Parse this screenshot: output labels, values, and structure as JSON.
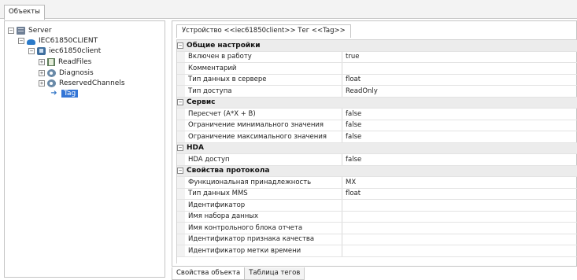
{
  "top_tab": {
    "label": "Объекты"
  },
  "tree": {
    "server": "Server",
    "client": "IEC61850CLIENT",
    "device": "iec61850client",
    "readfiles": "ReadFiles",
    "diagnosis": "Diagnosis",
    "reserved": "ReservedChannels",
    "tag": "Tag"
  },
  "device_tab": {
    "label": "Устройство <<iec61850client>> Тег  <<Tag>>"
  },
  "grid": {
    "cat_general": "Общие настройки",
    "enabled_label": "Включен в работу",
    "enabled_value": "true",
    "comment_label": "Комментарий",
    "server_type_label": "Тип данных в сервере",
    "server_type_value": "float",
    "access_label": "Тип доступа",
    "access_value": "ReadOnly",
    "cat_service": "Сервис",
    "recalc_label": "Пересчет (A*X + B)",
    "recalc_value": "false",
    "min_label": "Ограничение минимального значения",
    "min_value": "false",
    "max_label": "Ограничение максимального значения",
    "max_value": "false",
    "cat_hda": "HDA",
    "hda_label": "HDA доступ",
    "hda_value": "false",
    "cat_protocol": "Свойства протокола",
    "fc_label": "Функциональная принадлежность",
    "fc_value": "MX",
    "mms_label": "Тип данных MMS",
    "mms_value": "float",
    "id_label": "Идентификатор",
    "dataset_label": "Имя набора данных",
    "rcb_label": "Имя контрольного блока отчета",
    "quality_label": "Идентификатор признака качества",
    "timestamp_label": "Идентификатор метки времени"
  },
  "bottom_tabs": {
    "props": "Свойства объекта",
    "tags": "Таблица тегов"
  },
  "icons": {
    "expanded": "minus-box",
    "collapsed": "plus-box",
    "tag_arrow": "arrow-right"
  },
  "colors": {
    "selection": "#3375d6",
    "category_bg": "#ececec"
  }
}
